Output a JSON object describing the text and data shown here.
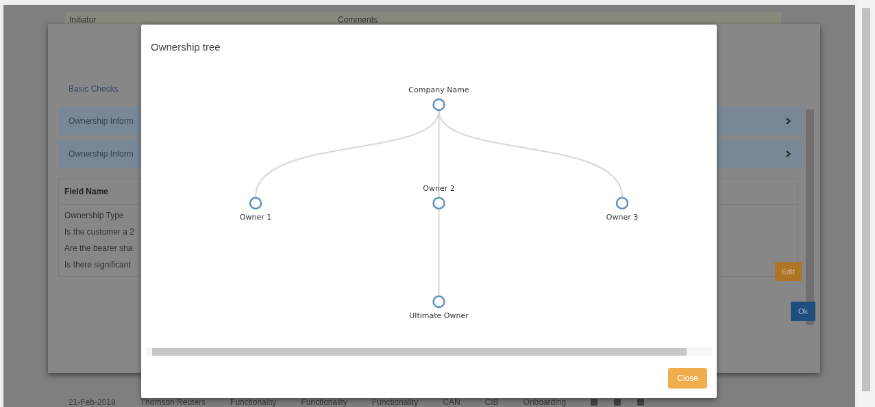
{
  "background_table": {
    "columns": [
      "Initiator",
      "Comments"
    ],
    "row": [
      "21-Feb-2018",
      "Thomson Reuters",
      "Functionality",
      "Functionality",
      "Functionality",
      "CAN",
      "CIB",
      "Onboarding"
    ]
  },
  "review_dialog": {
    "sections": [
      {
        "label": "Basic Checks",
        "kind": "link"
      },
      {
        "label": "Ownership Inform",
        "kind": "panel"
      },
      {
        "label": "Ownership Inform",
        "kind": "panel"
      }
    ],
    "table": {
      "columns": [
        "Field Name"
      ],
      "rows": [
        "Ownership Type",
        "Is the customer a 2",
        "Are the bearer sha",
        "Is there significant"
      ]
    },
    "buttons": {
      "edit": "Edit",
      "ok": "Ok"
    }
  },
  "modal": {
    "title": "Ownership tree",
    "tree": {
      "label": "Company Name",
      "children": [
        {
          "label": "Owner 1"
        },
        {
          "label": "Owner 2",
          "children": [
            {
              "label": "Ultimate Owner"
            }
          ]
        },
        {
          "label": "Owner 3"
        }
      ]
    },
    "close_button": "Close"
  }
}
